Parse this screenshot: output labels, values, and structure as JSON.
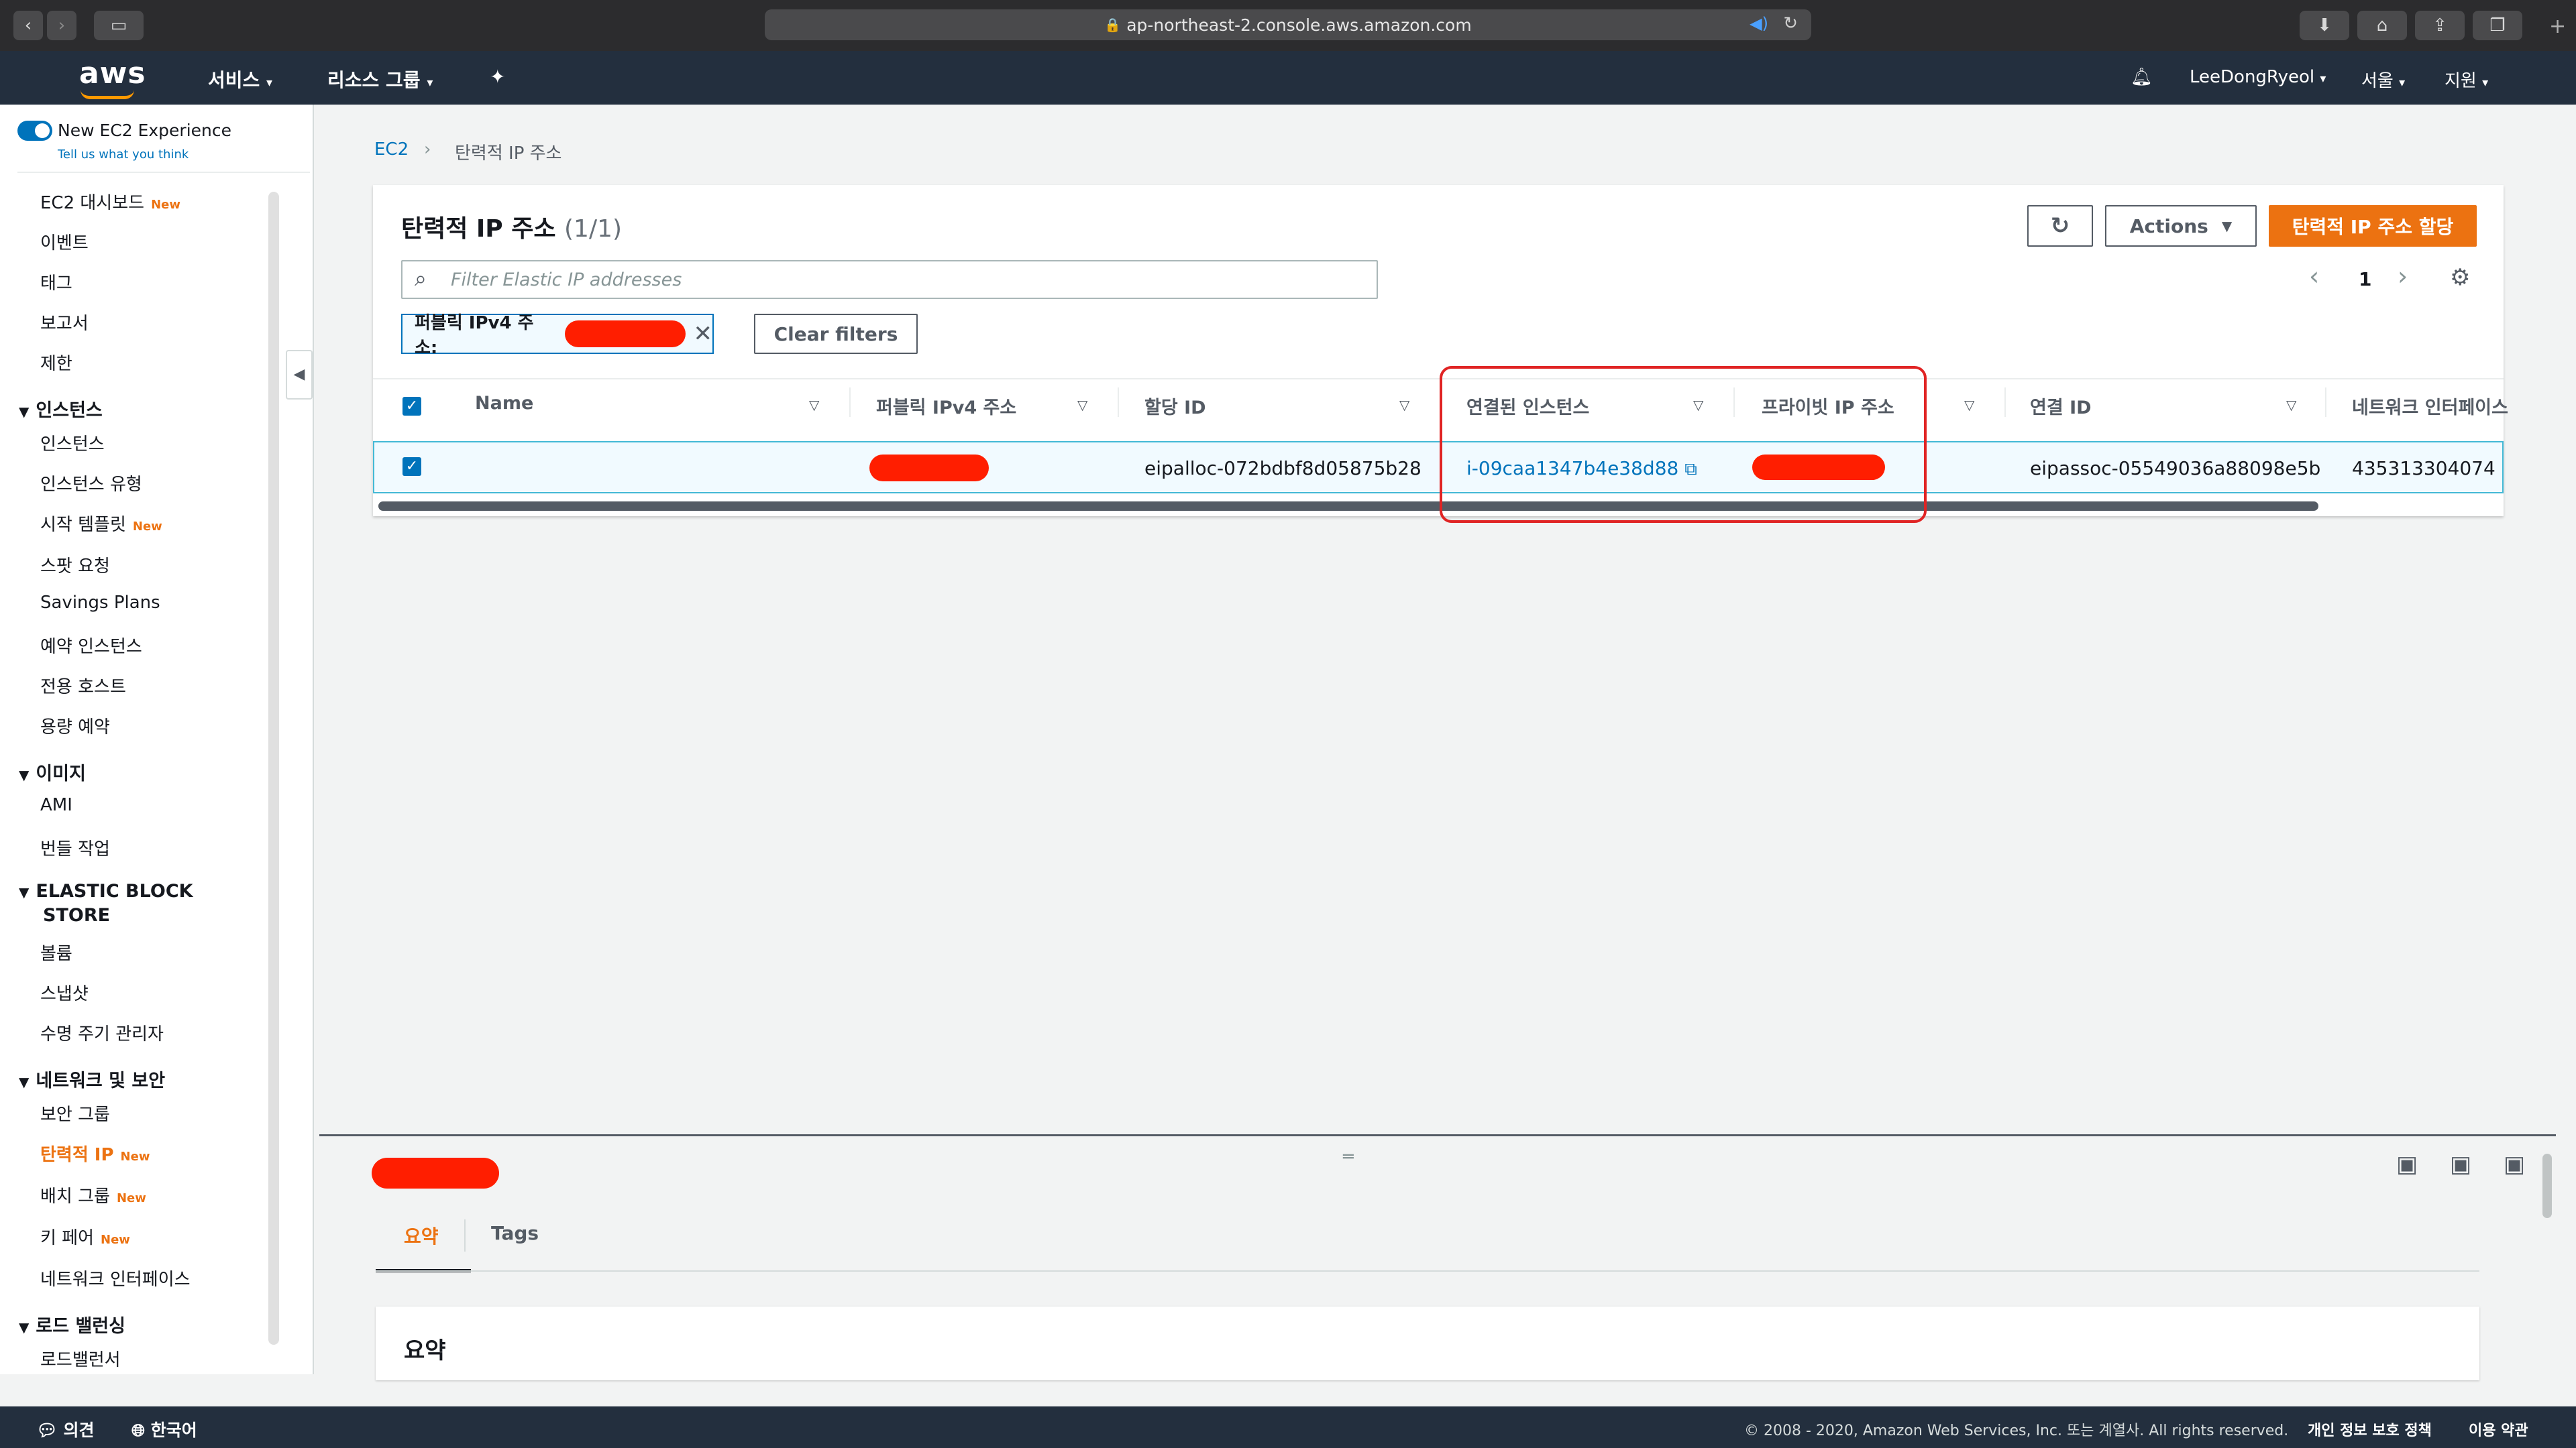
{
  "browser": {
    "url": "ap-northeast-2.console.aws.amazon.com"
  },
  "navbar": {
    "logo": "aws",
    "services": "서비스",
    "resource_groups": "리소스 그룹",
    "user": "LeeDongRyeol",
    "region": "서울",
    "support": "지원"
  },
  "sidebar": {
    "new_experience": "New EC2 Experience",
    "tell_us": "Tell us what you think",
    "new_badge": "New",
    "top_items": [
      "EC2 대시보드",
      "이벤트",
      "태그",
      "보고서",
      "제한"
    ],
    "sections": [
      {
        "title": "인스턴스",
        "items": [
          "인스턴스",
          "인스턴스 유형",
          "시작 템플릿",
          "스팟 요청",
          "Savings Plans",
          "예약 인스턴스",
          "전용 호스트",
          "용량 예약"
        ]
      },
      {
        "title": "이미지",
        "items": [
          "AMI",
          "번들 작업"
        ]
      },
      {
        "title_line1": "ELASTIC BLOCK",
        "title_line2": "STORE",
        "items": [
          "볼륨",
          "스냅샷",
          "수명 주기 관리자"
        ]
      },
      {
        "title": "네트워크 및 보안",
        "items": [
          "보안 그룹",
          "탄력적 IP",
          "배치 그룹",
          "키 페어",
          "네트워크 인터페이스"
        ]
      },
      {
        "title": "로드 밸런싱",
        "items": [
          "로드밸런서"
        ]
      }
    ]
  },
  "breadcrumb": {
    "root": "EC2",
    "current": "탄력적 IP 주소"
  },
  "panel": {
    "title": "탄력적 IP 주소",
    "count": "(1/1)",
    "actions_label": "Actions",
    "allocate_label": "탄력적 IP 주소 할당",
    "filter_placeholder": "Filter Elastic IP addresses",
    "token_label": "퍼블릭 IPv4 주소:",
    "clear_filters": "Clear filters",
    "page": "1",
    "columns": [
      "Name",
      "퍼블릭 IPv4 주소",
      "할당 ID",
      "연결된 인스턴스",
      "프라이빗 IP 주소",
      "연결 ID",
      "네트워크 인터페이스"
    ],
    "row": {
      "allocation_id": "eipalloc-072bdbf8d05875b28",
      "instance": "i-09caa1347b4e38d88",
      "association_id": "eipassoc-05549036a88098e5b",
      "network_interface": "435313304074"
    }
  },
  "detail": {
    "tabs": [
      "요약",
      "Tags"
    ],
    "section_title": "요약"
  },
  "footer": {
    "feedback": "의견",
    "language": "한국어",
    "copyright": "© 2008 - 2020, Amazon Web Services, Inc. 또는 계열사. All rights reserved.",
    "privacy": "개인 정보 보호 정책",
    "terms": "이용 약관"
  },
  "colors": {
    "accent": "#ec7211",
    "link": "#0073bb",
    "navbar": "#232f3e",
    "highlight_box": "#e02424",
    "redaction": "#ff1e00"
  }
}
